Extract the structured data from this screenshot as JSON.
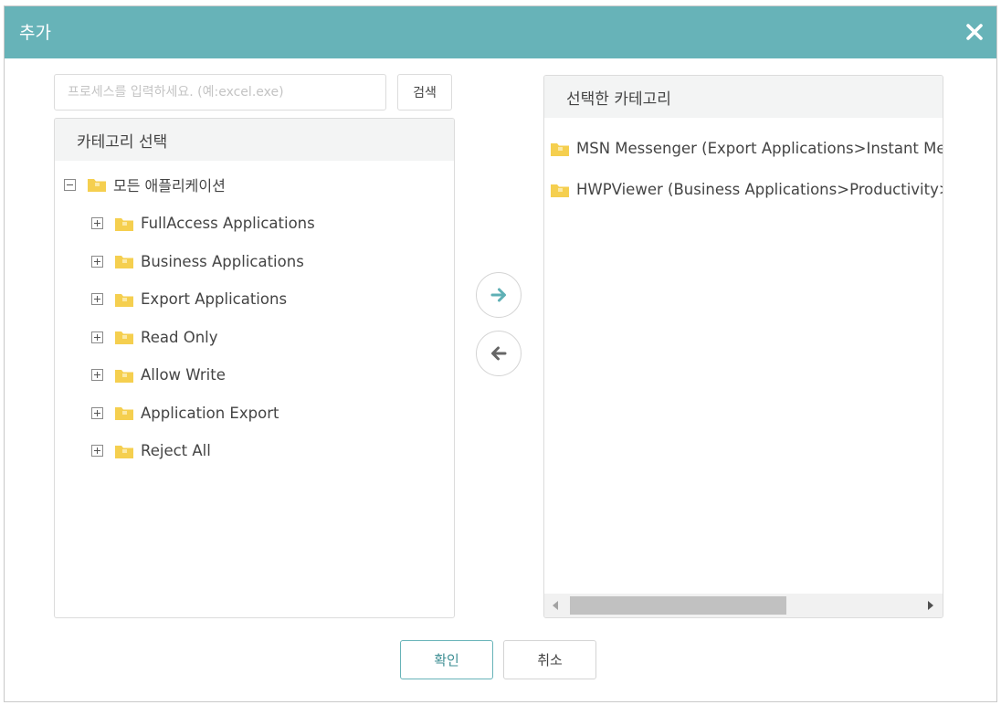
{
  "dialog": {
    "title": "추가",
    "close_icon": "close-icon"
  },
  "search": {
    "placeholder": "프로세스를 입력하세요. (예:excel.exe)",
    "value": "",
    "button_label": "검색"
  },
  "category_panel": {
    "header": "카테고리 선택",
    "root": {
      "label": "모든 애플리케이션",
      "toggle": "minus",
      "icon": "folder-icon"
    },
    "items": [
      {
        "label": "FullAccess Applications",
        "toggle": "plus",
        "icon": "folder-icon"
      },
      {
        "label": "Business Applications",
        "toggle": "plus",
        "icon": "folder-icon"
      },
      {
        "label": "Export Applications",
        "toggle": "plus",
        "icon": "folder-icon"
      },
      {
        "label": "Read Only",
        "toggle": "plus",
        "icon": "folder-icon"
      },
      {
        "label": "Allow Write",
        "toggle": "plus",
        "icon": "folder-icon"
      },
      {
        "label": "Application Export",
        "toggle": "plus",
        "icon": "folder-icon"
      },
      {
        "label": "Reject All",
        "toggle": "plus",
        "icon": "folder-icon"
      }
    ]
  },
  "selected_panel": {
    "header": "선택한 카테고리",
    "items": [
      {
        "label": "MSN Messenger (Export Applications>Instant Mess",
        "icon": "folder-icon"
      },
      {
        "label": "HWPViewer (Business Applications>Productivity>W",
        "icon": "folder-icon"
      }
    ],
    "scrollbar_position": 0.0
  },
  "transfer": {
    "add_icon": "arrow-right-icon",
    "remove_icon": "arrow-left-icon"
  },
  "footer": {
    "ok_label": "확인",
    "cancel_label": "취소"
  },
  "colors": {
    "titlebar": "#67b3b8",
    "folder": "#f5cf4f",
    "accent_arrow": "#5fb0b5",
    "ok_border": "#67b3b8"
  }
}
